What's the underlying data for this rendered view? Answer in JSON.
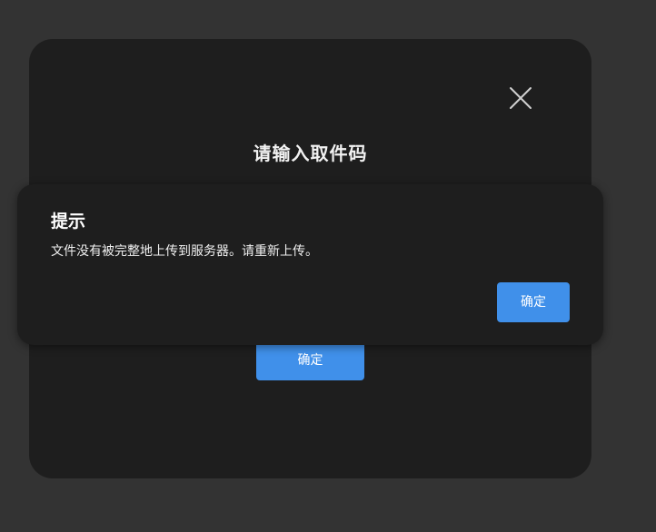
{
  "dialog": {
    "title": "请输入取件码",
    "confirm_label": "确定",
    "close_icon": "close-icon"
  },
  "alert": {
    "title": "提示",
    "message": "文件没有被完整地上传到服务器。请重新上传。",
    "confirm_label": "确定"
  },
  "colors": {
    "background": "#333333",
    "panel": "#1e1e1e",
    "accent": "#4090ea",
    "text": "#ffffff"
  }
}
